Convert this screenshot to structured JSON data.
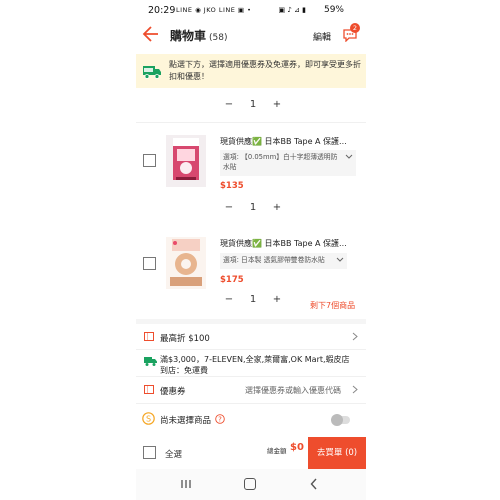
{
  "status_bar": {
    "time": "20:29",
    "left_icons": "LINE ◉ JKO LINE ▣ •",
    "right_icons": "▣ ♪ ⊿ ▮",
    "battery": "59%"
  },
  "header": {
    "title": "購物車",
    "count": "(58)",
    "edit_label": "編輯",
    "chat_badge": "2"
  },
  "promo": {
    "icon": "free-shipping-icon",
    "text": "點選下方，選擇適用優惠券及免運券，即可享受更多折扣和優惠！"
  },
  "top_stepper": {
    "minus": "−",
    "qty": "1",
    "plus": "+"
  },
  "products": [
    {
      "name": "現貨供應✅ 日本BB Tape A 保護...",
      "variant": "選項: 【0.05mm】白十字超薄透明防水貼",
      "price": "$135",
      "qty": "1",
      "minus": "−",
      "plus": "+"
    },
    {
      "name": "現貨供應✅ 日本BB Tape A 保護...",
      "variant": "選項: 日本製 透氣膠帶雙卷防水貼",
      "price": "$175",
      "qty": "1",
      "minus": "−",
      "plus": "+",
      "stock_note": "剩下7個商品"
    }
  ],
  "discount_row": {
    "text": "最高折 $100"
  },
  "shipping_row": {
    "text": "滿$3,000，7-ELEVEN,全家,萊爾富,OK Mart,蝦皮店到店：免運費"
  },
  "voucher_row": {
    "label": "優惠券",
    "hint": "選擇優惠券或輸入優惠代碼"
  },
  "coins_row": {
    "label": "尚未選擇商品"
  },
  "checkout": {
    "select_all": "全選",
    "total_label": "總金額",
    "total": "$0",
    "button": "去買單 (0)"
  },
  "colors": {
    "accent": "#ee4d2d",
    "promo_bg": "#fef6da"
  }
}
